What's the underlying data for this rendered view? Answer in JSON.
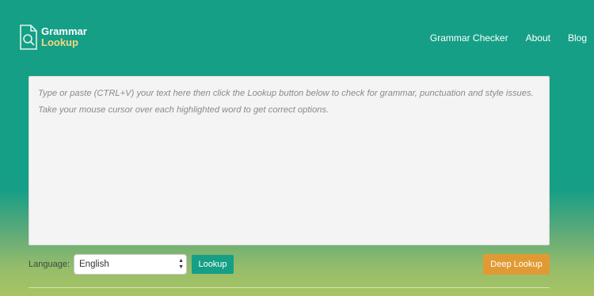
{
  "header": {
    "logo": {
      "line1": "Grammar",
      "line2": "Lookup"
    },
    "nav": [
      {
        "label": "Grammar Checker"
      },
      {
        "label": "About"
      },
      {
        "label": "Blog"
      }
    ]
  },
  "editor": {
    "placeholder_line1": "Type or paste (CTRL+V) your text here then click the Lookup button below to check for grammar, punctuation and style issues.",
    "placeholder_line2": "Take your mouse cursor over each highlighted word to get correct options."
  },
  "controls": {
    "language_label": "Language:",
    "language_selected": "English",
    "lookup_label": "Lookup",
    "deep_lookup_label": "Deep Lookup"
  },
  "colors": {
    "header_bg": "#159f86",
    "lookup_button": "#159f86",
    "deep_lookup_button": "#e19a33",
    "logo_accent": "#f3d77d"
  }
}
